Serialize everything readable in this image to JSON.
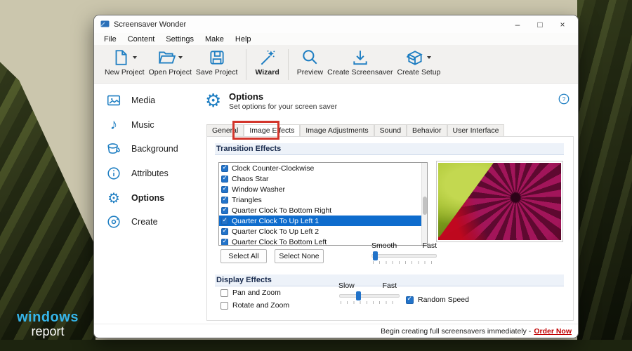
{
  "desktop": {
    "logo_line1": "windows",
    "logo_line2": "report"
  },
  "window": {
    "title": "Screensaver Wonder",
    "controls": {
      "minimize": "–",
      "maximize": "□",
      "close": "×"
    },
    "menu": [
      "File",
      "Content",
      "Settings",
      "Make",
      "Help"
    ],
    "toolbar": [
      {
        "label": "New Project",
        "icon": "new-project-icon",
        "has_dropdown": true
      },
      {
        "label": "Open Project",
        "icon": "open-project-icon",
        "has_dropdown": true
      },
      {
        "label": "Save Project",
        "icon": "save-project-icon",
        "has_dropdown": false
      },
      {
        "label": "Wizard",
        "icon": "wizard-icon",
        "has_dropdown": false
      },
      {
        "label": "Preview",
        "icon": "preview-icon",
        "has_dropdown": false
      },
      {
        "label": "Create Screensaver",
        "icon": "create-screensaver-icon",
        "has_dropdown": false
      },
      {
        "label": "Create Setup",
        "icon": "create-setup-icon",
        "has_dropdown": true
      }
    ],
    "sidebar": [
      {
        "label": "Media",
        "icon": "media-icon",
        "selected": false
      },
      {
        "label": "Music",
        "icon": "music-icon",
        "selected": false
      },
      {
        "label": "Background",
        "icon": "background-icon",
        "selected": false
      },
      {
        "label": "Attributes",
        "icon": "attributes-icon",
        "selected": false
      },
      {
        "label": "Options",
        "icon": "options-icon",
        "selected": true
      },
      {
        "label": "Create",
        "icon": "create-icon",
        "selected": false
      }
    ],
    "options_header": {
      "title": "Options",
      "subtitle": "Set options for your screen saver",
      "gear_glyph": "⚙"
    },
    "tabs": [
      "General",
      "Image Effects",
      "Image Adjustments",
      "Sound",
      "Behavior",
      "User Interface"
    ],
    "selected_tab": "Image Effects",
    "annotation": {
      "type": "red-highlight-box",
      "color": "#d3352b",
      "target": "Image Effects"
    },
    "transition": {
      "header": "Transition Effects",
      "effects": [
        {
          "label": "Clock Counter-Clockwise",
          "checked": true,
          "selected": false
        },
        {
          "label": "Chaos Star",
          "checked": true,
          "selected": false
        },
        {
          "label": "Window Washer",
          "checked": true,
          "selected": false
        },
        {
          "label": "Triangles",
          "checked": true,
          "selected": false
        },
        {
          "label": "Quarter Clock To Bottom Right",
          "checked": true,
          "selected": false
        },
        {
          "label": "Quarter Clock To Up Left 1",
          "checked": true,
          "selected": true
        },
        {
          "label": "Quarter Clock To Up Left 2",
          "checked": true,
          "selected": false
        },
        {
          "label": "Quarter Clock To Bottom Left",
          "checked": true,
          "selected": false
        }
      ],
      "select_all": "Select All",
      "select_none": "Select None",
      "speed_slider": {
        "left_label": "Smooth",
        "right_label": "Fast",
        "value_pct": 3
      }
    },
    "display": {
      "header": "Display Effects",
      "pan_zoom": {
        "label": "Pan and Zoom",
        "checked": false
      },
      "rotate_zoom": {
        "label": "Rotate and Zoom",
        "checked": false
      },
      "speed_slider": {
        "left_label": "Slow",
        "right_label": "Fast",
        "value_pct": 28
      },
      "random_speed": {
        "label": "Random Speed",
        "checked": true
      }
    },
    "statusbar": {
      "promo": "Begin creating full screensavers immediately -",
      "link": "Order Now"
    }
  },
  "music_glyph": "♪",
  "gear_glyph": "⚙",
  "accent_colors": {
    "icon_blue": "#1e7ec2",
    "selection_blue": "#0e6ccd",
    "checkbox_blue": "#2273c9",
    "order_red": "#c00000"
  }
}
